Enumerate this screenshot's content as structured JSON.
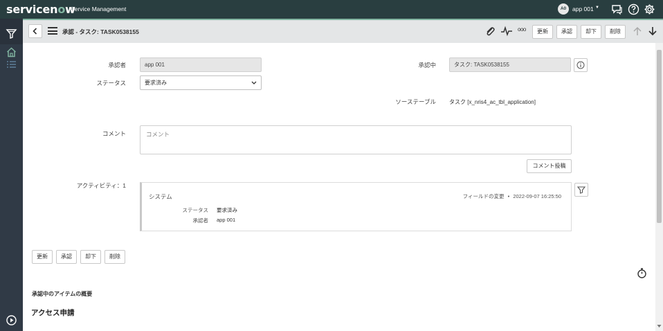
{
  "banner": {
    "logo_main": "servicen",
    "logo_o": "o",
    "logo_end": "w",
    "app_name": "Service Management",
    "user_initials": "A0",
    "user_name": "app 001",
    "user_caret": "▼",
    "icons": [
      "chat-icon",
      "help-icon",
      "gear-icon"
    ]
  },
  "leftnav": {
    "icons": [
      "filter-icon",
      "home-icon",
      "list-icon",
      "play-icon"
    ]
  },
  "header": {
    "title": "承認 - タスク: TASK0538155",
    "buttons": {
      "update": "更新",
      "approve": "承認",
      "reject": "却下",
      "delete": "削除"
    },
    "more": "ooo"
  },
  "form": {
    "approver_label": "承認者",
    "approver_value": "app 001",
    "status_label": "ステータス",
    "status_value": "要求済み",
    "approving_label": "承認中",
    "approving_value": "タスク: TASK0538155",
    "source_table_label": "ソーステーブル",
    "source_table_value": "タスク [x_nris4_ac_tbl_application]",
    "comment_label": "コメント",
    "comment_placeholder": "コメント",
    "post_comment_button": "コメント投稿",
    "activity_label": "アクティビティ：1"
  },
  "activity": {
    "source": "システム",
    "change_type": "フィールドの変更",
    "dot": "•",
    "timestamp": "2022-09-07 16:25:50",
    "rows": [
      {
        "label": "ステータス",
        "value": "要求済み"
      },
      {
        "label": "承認者",
        "value": "app 001"
      }
    ]
  },
  "bottom_buttons": {
    "update": "更新",
    "approve": "承認",
    "reject": "却下",
    "delete": "削除"
  },
  "sections": {
    "summary": "承認中のアイテムの概要",
    "access_request": "アクセス申請"
  },
  "colors": {
    "banner_bg": "#293e40",
    "accent": "#81b5a1",
    "nav_bg": "#303a46",
    "header_bg": "#e4e6e7"
  }
}
